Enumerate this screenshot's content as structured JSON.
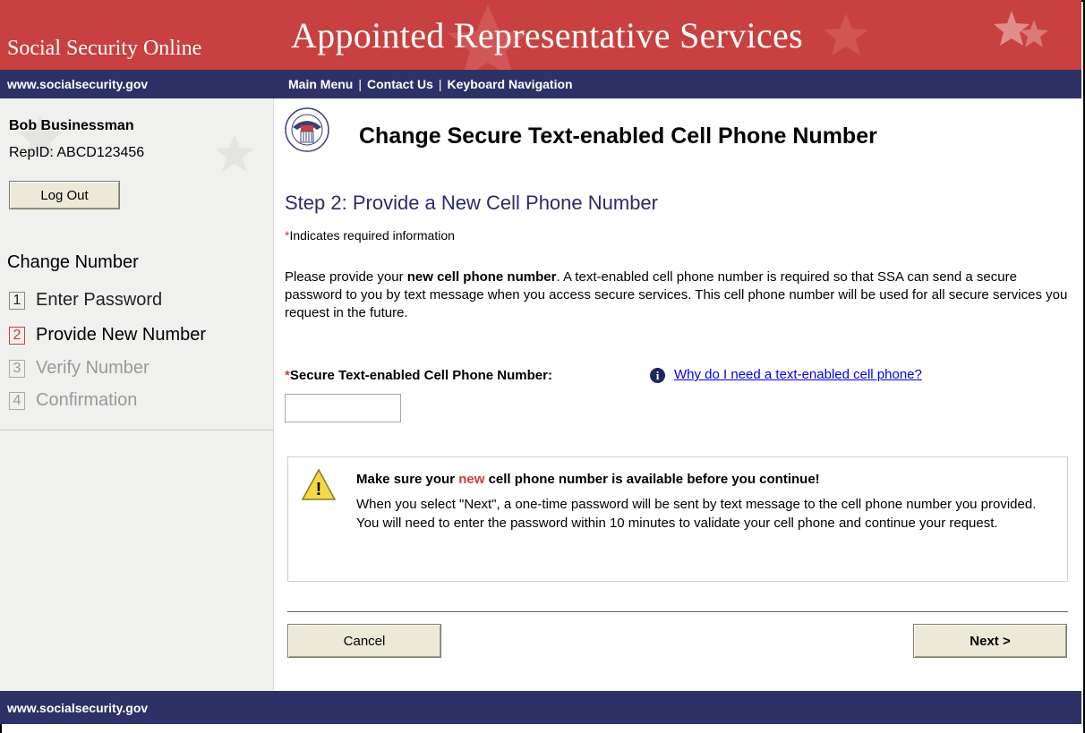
{
  "banner": {
    "site_title": "Social Security Online",
    "app_title": "Appointed Representative Services"
  },
  "nav": {
    "url": "www.socialsecurity.gov",
    "main_menu": "Main Menu",
    "contact_us": "Contact Us",
    "keyboard_navigation": "Keyboard Navigation",
    "separator": "|"
  },
  "sidebar": {
    "username": "Bob Businessman",
    "repid": "RepID:  ABCD123456",
    "logout_label": "Log Out",
    "steps_title": "Change Number",
    "steps": [
      {
        "num": "1",
        "label": "Enter Password",
        "state": "done"
      },
      {
        "num": "2",
        "label": "Provide New Number",
        "state": "current"
      },
      {
        "num": "3",
        "label": "Verify Number",
        "state": "future"
      },
      {
        "num": "4",
        "label": "Confirmation",
        "state": "future"
      }
    ]
  },
  "main": {
    "page_title": "Change Secure Text-enabled Cell Phone Number",
    "step_heading": "Step 2:  Provide a New Cell Phone Number",
    "required_marker": "*",
    "required_note": "Indicates required information",
    "intro_part1": "Please provide your ",
    "intro_bold": "new cell phone number",
    "intro_part2": ".  A text-enabled cell phone number is required so that SSA can send a secure password to you by text message when you access secure services. This cell phone number will be used for all secure services you request in the future.",
    "field_label": "Secure Text-enabled Cell Phone Number:",
    "info_icon_glyph": "i",
    "help_link": "Why do I need a text-enabled cell phone?",
    "phone_value": "",
    "warning": {
      "title_part1": "Make sure your ",
      "title_highlight": "new",
      "title_part2": " cell phone number is available before you continue!",
      "text": "When you select \"Next\", a one-time password will be sent by text message to the cell phone number you provided.  You will need to enter the password within 10 minutes to validate your cell phone and continue your request.",
      "icon_glyph": "!"
    },
    "cancel_label": "Cancel",
    "next_label": "Next >"
  },
  "footer": {
    "url": "www.socialsecurity.gov"
  },
  "colors": {
    "banner_red": "#c8403f",
    "nav_blue": "#2e3165",
    "sidebar_bg": "#f0f0ef",
    "link_blue": "#0000ee"
  },
  "icons": {
    "seal": "ssa-seal-icon",
    "info": "info-icon",
    "warning": "warning-icon"
  }
}
